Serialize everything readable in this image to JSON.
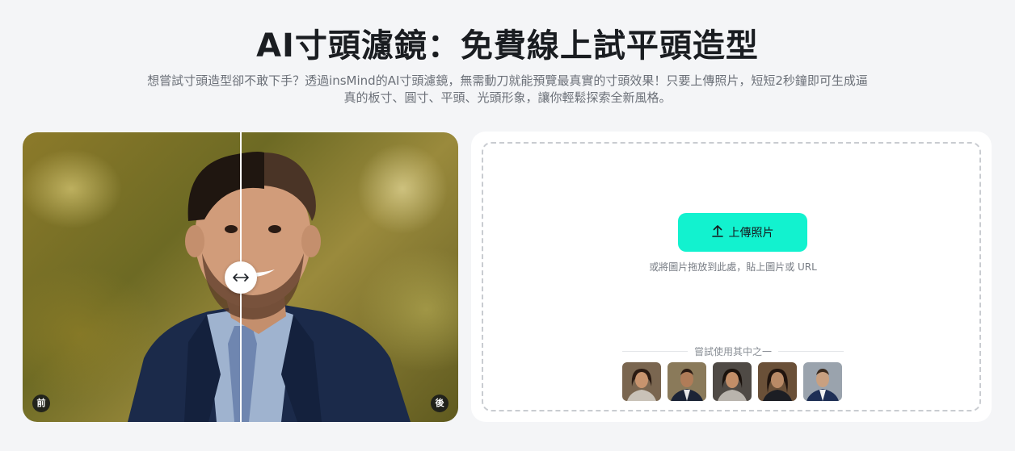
{
  "header": {
    "title": "AI寸頭濾鏡：免費線上試平頭造型",
    "subtitle_line1": "想嘗試寸頭造型卻不敢下手？透過insMind的AI寸頭濾鏡，無需動刀就能預覽最真實的寸頭效果！只要上傳照片，短短2秒鐘即可生成逼",
    "subtitle_line2": "真的板寸、圓寸、平頭、光頭形象，讓你輕鬆探索全新風格。"
  },
  "compare": {
    "before_label": "前",
    "after_label": "後"
  },
  "upload": {
    "button_label": "上傳照片",
    "drop_hint": "或將圖片拖放到此處，貼上圖片或 URL",
    "try_label": "嘗試使用其中之一"
  },
  "colors": {
    "accent": "#12f2cf",
    "page_bg": "#f4f5f7",
    "title": "#1a1d21",
    "subtitle": "#6b7078"
  },
  "icons": {
    "upload": "upload-arrow-icon",
    "handle": "left-right-arrow-icon"
  }
}
